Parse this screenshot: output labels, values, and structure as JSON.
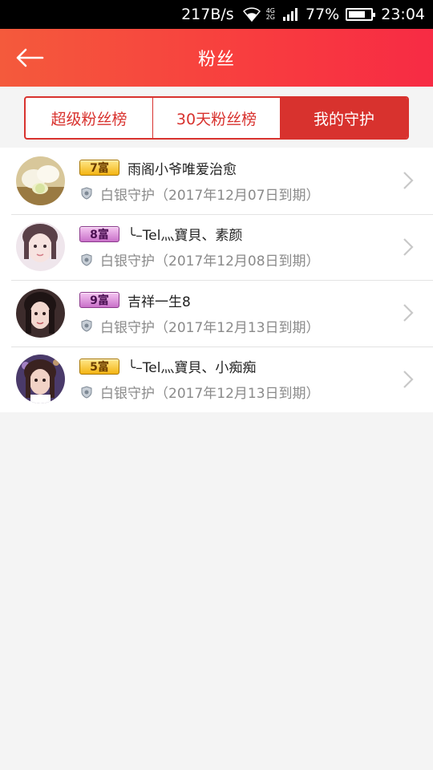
{
  "status_bar": {
    "speed": "217B/s",
    "net_top": "4G",
    "net_bottom": "2G",
    "battery": "77%",
    "time": "23:04",
    "battery_level": 0.77
  },
  "header": {
    "title": "粉丝",
    "back_icon": "arrow-left-icon"
  },
  "tabs": [
    {
      "label": "超级粉丝榜",
      "active": false
    },
    {
      "label": "30天粉丝榜",
      "active": false
    },
    {
      "label": "我的守护",
      "active": true
    }
  ],
  "fans": [
    {
      "badge": "7富",
      "badge_color": "gold",
      "name": "雨阁小爷唯爱治愈",
      "guard": "白银守护",
      "expiry": "（2017年12月07日到期）"
    },
    {
      "badge": "8富",
      "badge_color": "purple",
      "name": "╰–Tel灬寶貝、素颜",
      "guard": "白银守护",
      "expiry": "（2017年12月08日到期）"
    },
    {
      "badge": "9富",
      "badge_color": "purple",
      "name": "吉祥一生8",
      "guard": "白银守护",
      "expiry": "（2017年12月13日到期）"
    },
    {
      "badge": "5富",
      "badge_color": "gold",
      "name": "╰–Tel灬寶貝、小痴痴",
      "guard": "白银守护",
      "expiry": "（2017年12月13日到期）"
    }
  ],
  "colors": {
    "accent": "#d8322e",
    "header_start": "#f45a3c",
    "header_end": "#f72b44"
  }
}
